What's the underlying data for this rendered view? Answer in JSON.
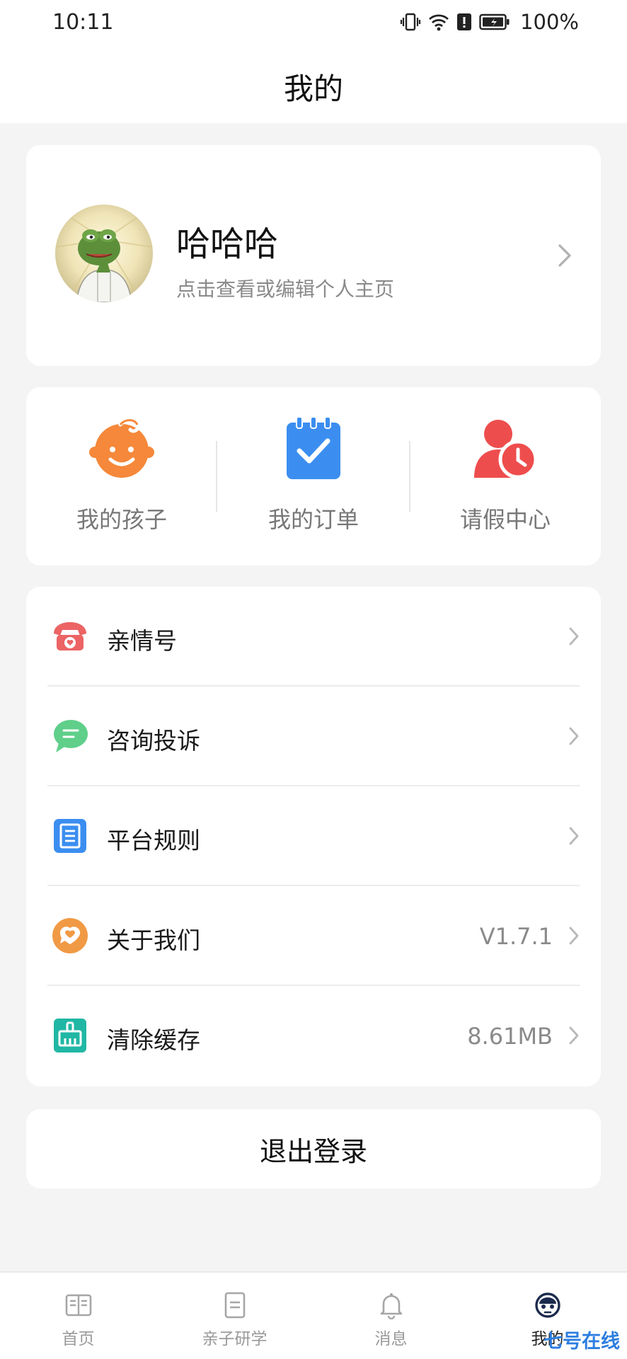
{
  "status_bar": {
    "time": "10:11",
    "battery": "100%"
  },
  "header": {
    "title": "我的"
  },
  "profile": {
    "name": "哈哈哈",
    "subtitle": "点击查看或编辑个人主页"
  },
  "quick_actions": [
    {
      "label": "我的孩子",
      "icon": "child-face-icon",
      "color": "#f5883a"
    },
    {
      "label": "我的订单",
      "icon": "order-clipboard-icon",
      "color": "#3b8ef0"
    },
    {
      "label": "请假中心",
      "icon": "person-clock-icon",
      "color": "#ee4d4d"
    }
  ],
  "menu": [
    {
      "label": "亲情号",
      "value": "",
      "icon": "phone-heart-icon",
      "color": "#ec6464"
    },
    {
      "label": "咨询投诉",
      "value": "",
      "icon": "chat-bubble-icon",
      "color": "#5fcf8a"
    },
    {
      "label": "平台规则",
      "value": "",
      "icon": "document-icon",
      "color": "#3b8ef0"
    },
    {
      "label": "关于我们",
      "value": "V1.7.1",
      "icon": "heart-chat-icon",
      "color": "#f19a45"
    },
    {
      "label": "清除缓存",
      "value": "8.61MB",
      "icon": "broom-icon",
      "color": "#20b7a4"
    }
  ],
  "logout": {
    "label": "退出登录"
  },
  "tabs": [
    {
      "label": "首页",
      "icon": "book-icon",
      "active": false
    },
    {
      "label": "亲子研学",
      "icon": "notebook-icon",
      "active": false
    },
    {
      "label": "消息",
      "icon": "bell-icon",
      "active": false
    },
    {
      "label": "我的",
      "icon": "robot-face-icon",
      "active": true
    }
  ],
  "watermark": {
    "text": "七号在线"
  }
}
